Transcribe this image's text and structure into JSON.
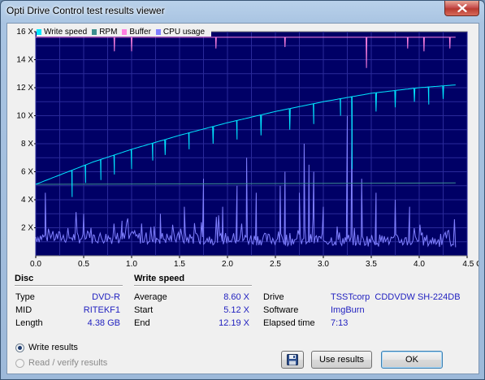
{
  "window": {
    "title": "Opti Drive Control test results viewer"
  },
  "legend": [
    {
      "label": "Write speed",
      "color": "#00e8ff"
    },
    {
      "label": "RPM",
      "color": "#3d8f8f"
    },
    {
      "label": "Buffer",
      "color": "#ff80e0"
    },
    {
      "label": "CPU usage",
      "color": "#8080ff"
    }
  ],
  "chart_data": {
    "type": "line",
    "xlabel": "",
    "ylabel": "",
    "x_unit": "GB",
    "xlim": [
      0,
      4.5
    ],
    "ylim": [
      0,
      16
    ],
    "x_ticks": [
      "0.0",
      "0.5",
      "1.0",
      "1.5",
      "2.0",
      "2.5",
      "3.0",
      "3.5",
      "4.0",
      "4.5 GB"
    ],
    "y_ticks": [
      "2 X",
      "4 X",
      "6 X",
      "8 X",
      "10 X",
      "12 X",
      "14 X",
      "16 X"
    ],
    "background": "#000066",
    "grid": true,
    "series": [
      {
        "name": "Write speed",
        "color": "#00e8ff",
        "x": [
          0,
          0.3,
          0.6,
          1.0,
          1.5,
          2.0,
          2.5,
          3.0,
          3.5,
          4.0,
          4.38
        ],
        "y": [
          5.1,
          5.9,
          6.7,
          7.6,
          8.6,
          9.5,
          10.3,
          11.0,
          11.6,
          12.0,
          12.2
        ],
        "dips_x": [
          0.38,
          0.52,
          0.68,
          0.82,
          1.0,
          1.22,
          1.35,
          1.6,
          1.85,
          2.1,
          2.35,
          2.65,
          2.9,
          3.18,
          3.3,
          3.55,
          3.75,
          3.95,
          4.1,
          4.25
        ],
        "dips_y": [
          4.2,
          5.2,
          5.4,
          5.8,
          6.2,
          6.8,
          7.2,
          7.6,
          8.0,
          8.3,
          8.6,
          9.0,
          9.4,
          10.0,
          6.2,
          10.3,
          10.6,
          11.0,
          10.8,
          11.2
        ]
      },
      {
        "name": "RPM",
        "color": "#3d8f8f",
        "x": [
          0,
          4.38
        ],
        "y": [
          5.1,
          5.2
        ]
      },
      {
        "name": "Buffer",
        "color": "#ff80e0",
        "x": [
          0,
          4.38
        ],
        "y": [
          15.6,
          15.6
        ],
        "dips_x": [
          0.82,
          1.0,
          1.88,
          2.6,
          3.45,
          3.88,
          4.05,
          4.32
        ],
        "dips_y": [
          14.6,
          14.6,
          14.8,
          14.9,
          13.4,
          14.8,
          14.6,
          14.8
        ]
      },
      {
        "name": "CPU usage",
        "color": "#8080ff",
        "x": [
          0,
          4.38
        ],
        "y": [
          0.9,
          0.6
        ],
        "spikes_x": [
          0.1,
          0.5,
          0.9,
          1.3,
          1.55,
          1.75,
          1.95,
          2.1,
          2.2,
          2.3,
          2.55,
          2.6,
          2.75,
          2.8,
          2.85,
          2.9,
          3.0,
          3.25,
          3.3,
          3.4,
          3.55,
          3.75,
          3.9
        ],
        "spikes_y": [
          4.5,
          3.0,
          2.5,
          3.0,
          3.5,
          5.5,
          3.5,
          5.0,
          7.0,
          4.5,
          5.0,
          6.0,
          4.5,
          8.0,
          6.5,
          6.0,
          3.5,
          10.0,
          11.0,
          5.5,
          4.5,
          4.0,
          3.5
        ]
      }
    ]
  },
  "disc": {
    "header": "Disc",
    "rows": [
      {
        "label": "Type",
        "value": "DVD-R"
      },
      {
        "label": "MID",
        "value": "RITEKF1"
      },
      {
        "label": "Length",
        "value": "4.38 GB"
      }
    ]
  },
  "write_speed": {
    "header": "Write speed",
    "rows": [
      {
        "label": "Average",
        "value": "8.60 X"
      },
      {
        "label": "Start",
        "value": "5.12 X"
      },
      {
        "label": "End",
        "value": "12.19 X"
      }
    ]
  },
  "info": {
    "rows": [
      {
        "label": "Drive",
        "value": "TSSTcorp  CDDVDW SH-224DB"
      },
      {
        "label": "Software",
        "value": "ImgBurn"
      },
      {
        "label": "Elapsed time",
        "value": "7:13"
      }
    ]
  },
  "options": {
    "write_results": "Write results",
    "read_verify": "Read / verify results",
    "selected": "write_results"
  },
  "buttons": {
    "save_icon": "floppy-disk-icon",
    "use_results": "Use results",
    "ok": "OK"
  }
}
